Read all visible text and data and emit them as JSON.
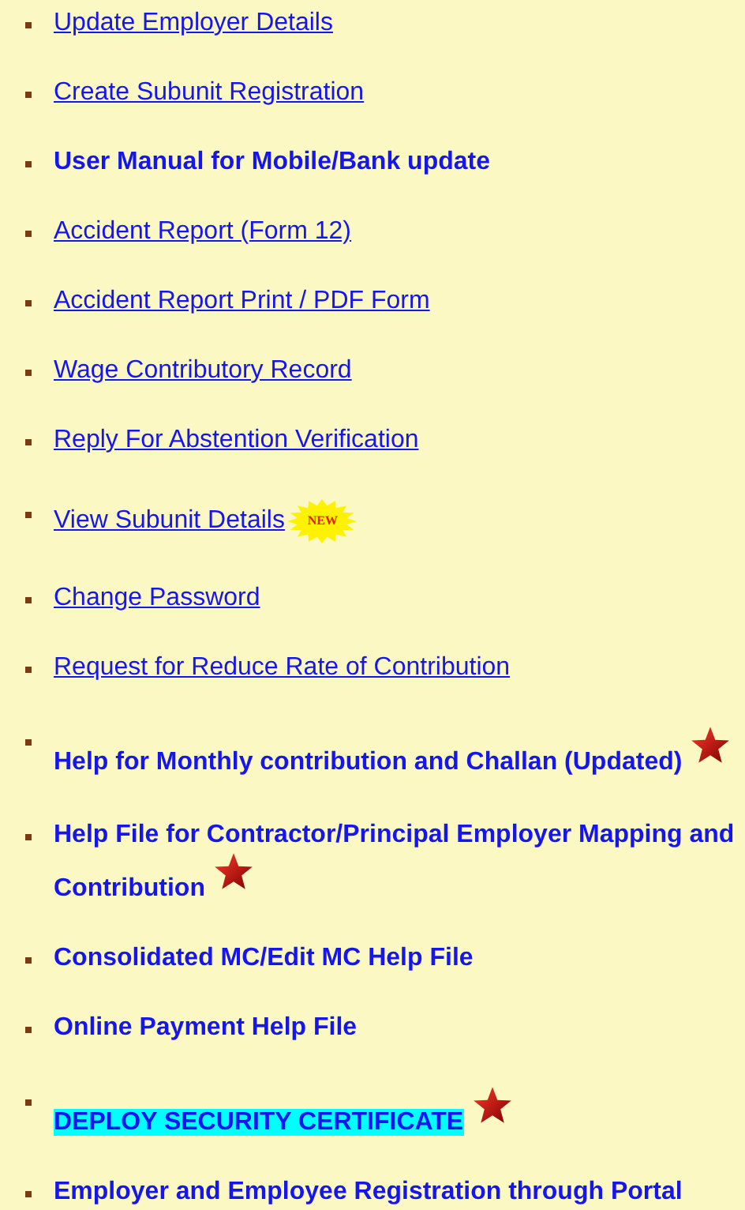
{
  "links": [
    {
      "text": "Update Employer Details",
      "kind": "link",
      "star": false,
      "highlighted": false
    },
    {
      "text": "Create Subunit Registration",
      "kind": "link",
      "star": false,
      "highlighted": false
    },
    {
      "text": "User Manual for Mobile/Bank update",
      "kind": "bold",
      "star": false,
      "highlighted": false
    },
    {
      "text": "Accident Report (Form 12)",
      "kind": "link",
      "star": false,
      "highlighted": false
    },
    {
      "text": "Accident Report Print / PDF Form",
      "kind": "link",
      "star": false,
      "highlighted": false
    },
    {
      "text": "Wage Contributory Record",
      "kind": "link",
      "star": false,
      "highlighted": false
    },
    {
      "text": "Reply For Abstention Verification",
      "kind": "link",
      "star": false,
      "highlighted": false
    },
    {
      "text": "View Subunit Details",
      "kind": "link",
      "star": false,
      "highlighted": false,
      "badge": "NEW"
    },
    {
      "text": "Change Password",
      "kind": "link",
      "star": false,
      "highlighted": false
    },
    {
      "text": "Request for Reduce Rate of Contribution",
      "kind": "link",
      "star": false,
      "highlighted": false
    },
    {
      "text": "Help for Monthly contribution and Challan (Updated)",
      "kind": "bold",
      "star": true,
      "highlighted": false
    },
    {
      "text": "Help File for Contractor/Principal Employer Mapping and Contribution",
      "kind": "bold",
      "star": true,
      "highlighted": false
    },
    {
      "text": "Consolidated MC/Edit MC Help File",
      "kind": "bold",
      "star": false,
      "highlighted": false
    },
    {
      "text": "Online Payment Help File",
      "kind": "bold",
      "star": false,
      "highlighted": false
    },
    {
      "text": "DEPLOY SECURITY CERTIFICATE",
      "kind": "bold",
      "star": true,
      "highlighted": true
    },
    {
      "text": "Employer and Employee Registration through Portal",
      "kind": "bold",
      "star": false,
      "highlighted": false
    }
  ]
}
